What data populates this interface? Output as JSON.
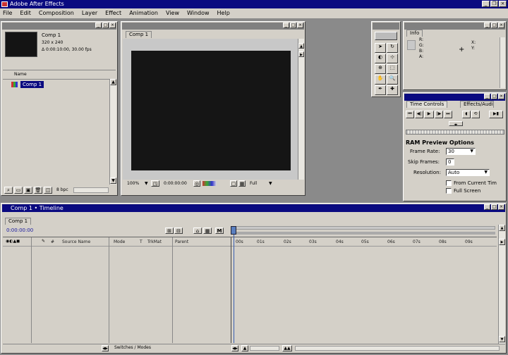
{
  "app": {
    "title": "Adobe After Effects"
  },
  "menu": [
    "File",
    "Edit",
    "Composition",
    "Layer",
    "Effect",
    "Animation",
    "View",
    "Window",
    "Help"
  ],
  "project": {
    "item_name": "Comp 1",
    "item_size": "320 x 240",
    "item_duration": "Δ 0:00:10:00, 30.00 fps",
    "col_name": "Name",
    "row_label": "Comp 1",
    "bpc": "8 bpc"
  },
  "comp": {
    "tab": "Comp 1",
    "zoom": "100%",
    "timecode": "0:00:00:00",
    "resolution": "Full"
  },
  "info": {
    "tab": "Info",
    "channels": [
      "R:",
      "G:",
      "B:",
      "A:"
    ],
    "coords": [
      "X:",
      "Y:"
    ]
  },
  "time_controls": {
    "tab": "Time Controls",
    "tab2": "Effects/Audio",
    "ram_title": "RAM Preview Options",
    "frame_rate_label": "Frame Rate:",
    "frame_rate_value": "30",
    "skip_frames_label": "Skip Frames:",
    "skip_frames_value": "0",
    "resolution_label": "Resolution:",
    "resolution_value": "Auto",
    "from_current": "From Current Tim",
    "full_screen": "Full Screen"
  },
  "timeline": {
    "title": "Comp 1 • Timeline",
    "tab": "Comp 1",
    "timecode": "0:00:00:00",
    "col_source": "Source Name",
    "col_mode": "Mode",
    "col_t": "T",
    "col_trkmat": "TrkMat",
    "col_parent": "Parent",
    "switches": "Switches / Modes",
    "ruler": [
      "00s",
      "01s",
      "02s",
      "03s",
      "04s",
      "05s",
      "06s",
      "07s",
      "08s",
      "09s"
    ]
  },
  "colors": {
    "title_active": "#0a0a80",
    "title_inactive": "#808080",
    "face": "#d4d0c8",
    "desktop": "#8a8a8a"
  }
}
